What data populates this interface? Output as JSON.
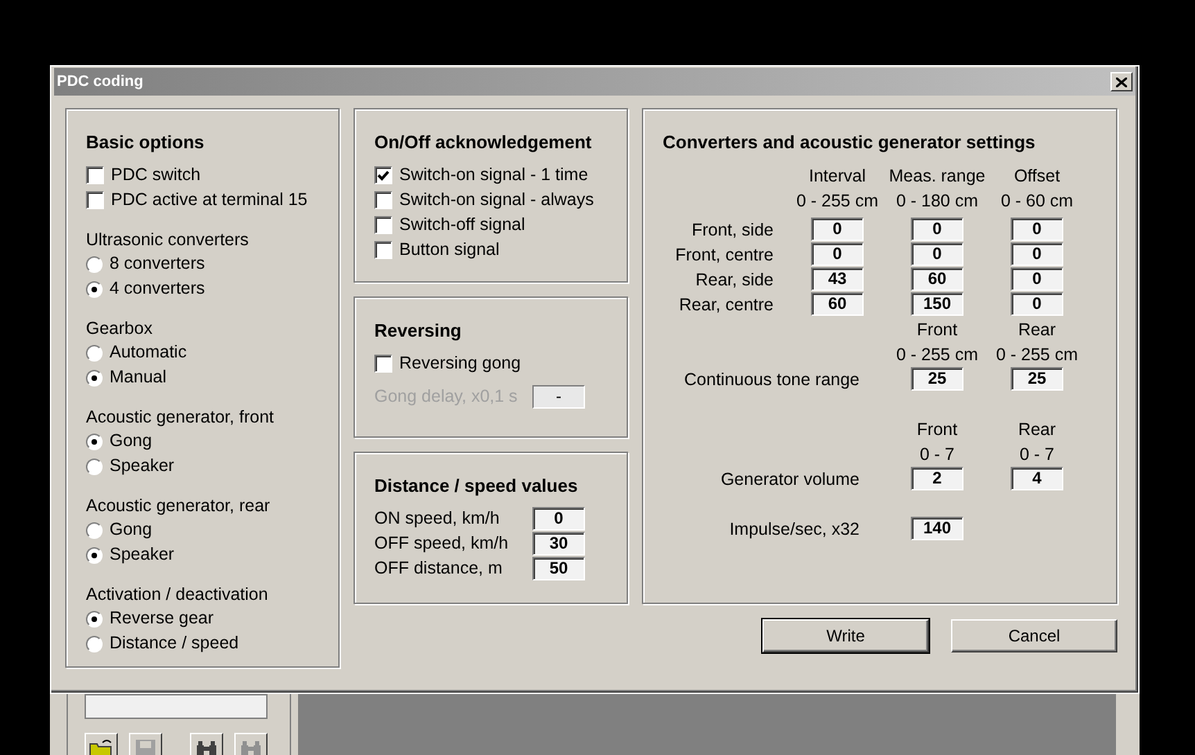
{
  "window": {
    "title": "PDC coding"
  },
  "basic_options": {
    "title": "Basic options",
    "checkboxes": [
      {
        "label": "PDC switch",
        "checked": false
      },
      {
        "label": "PDC active at terminal 15",
        "checked": false
      }
    ],
    "groups": [
      {
        "title": "Ultrasonic converters",
        "options": [
          {
            "label": "8 converters",
            "selected": false
          },
          {
            "label": "4 converters",
            "selected": true
          }
        ]
      },
      {
        "title": "Gearbox",
        "options": [
          {
            "label": "Automatic",
            "selected": false
          },
          {
            "label": "Manual",
            "selected": true
          }
        ]
      },
      {
        "title": "Acoustic generator, front",
        "options": [
          {
            "label": "Gong",
            "selected": true
          },
          {
            "label": "Speaker",
            "selected": false
          }
        ]
      },
      {
        "title": "Acoustic generator, rear",
        "options": [
          {
            "label": "Gong",
            "selected": false
          },
          {
            "label": "Speaker",
            "selected": true
          }
        ]
      },
      {
        "title": "Activation / deactivation",
        "options": [
          {
            "label": "Reverse gear",
            "selected": true
          },
          {
            "label": "Distance / speed",
            "selected": false
          }
        ]
      }
    ]
  },
  "on_off": {
    "title": "On/Off acknowledgement",
    "checkboxes": [
      {
        "label": "Switch-on signal - 1 time",
        "checked": true
      },
      {
        "label": "Switch-on signal - always",
        "checked": false
      },
      {
        "label": "Switch-off signal",
        "checked": false
      },
      {
        "label": "Button signal",
        "checked": false
      }
    ]
  },
  "reversing": {
    "title": "Reversing",
    "checkbox": {
      "label": "Reversing gong",
      "checked": false
    },
    "gong_delay": {
      "label": "Gong delay, x0,1 s",
      "value": "-",
      "disabled": true
    }
  },
  "distance_speed": {
    "title": "Distance / speed values",
    "fields": [
      {
        "label": "ON speed, km/h",
        "value": "0"
      },
      {
        "label": "OFF speed, km/h",
        "value": "30"
      },
      {
        "label": "OFF distance, m",
        "value": "50"
      }
    ]
  },
  "converters": {
    "title": "Converters and acoustic generator settings",
    "columns": [
      {
        "name": "Interval",
        "range": "0 - 255 cm"
      },
      {
        "name": "Meas. range",
        "range": "0 - 180 cm"
      },
      {
        "name": "Offset",
        "range": "0 - 60 cm"
      }
    ],
    "rows": [
      {
        "label": "Front, side",
        "values": [
          "0",
          "0",
          "0"
        ]
      },
      {
        "label": "Front, centre",
        "values": [
          "0",
          "0",
          "0"
        ]
      },
      {
        "label": "Rear, side",
        "values": [
          "43",
          "60",
          "0"
        ]
      },
      {
        "label": "Rear, centre",
        "values": [
          "60",
          "150",
          "0"
        ]
      }
    ],
    "continuous_tone": {
      "columns": [
        {
          "name": "Front",
          "range": "0 - 255 cm"
        },
        {
          "name": "Rear",
          "range": "0 - 255 cm"
        }
      ],
      "label": "Continuous tone range",
      "values": [
        "25",
        "25"
      ]
    },
    "generator_volume": {
      "columns": [
        {
          "name": "Front",
          "range": "0 - 7"
        },
        {
          "name": "Rear",
          "range": "0 - 7"
        }
      ],
      "label": "Generator volume",
      "values": [
        "2",
        "4"
      ]
    },
    "impulse": {
      "label": "Impulse/sec, x32",
      "value": "140"
    }
  },
  "buttons": [
    {
      "label": "Write",
      "default": true
    },
    {
      "label": "Cancel",
      "default": false
    }
  ],
  "background_window": {
    "toolbar": [
      {
        "kind": "folder",
        "disabled": false
      },
      {
        "kind": "save",
        "disabled": true
      },
      {
        "kind": "binoculars",
        "disabled": false
      },
      {
        "kind": "binoculars",
        "disabled": true
      }
    ]
  }
}
